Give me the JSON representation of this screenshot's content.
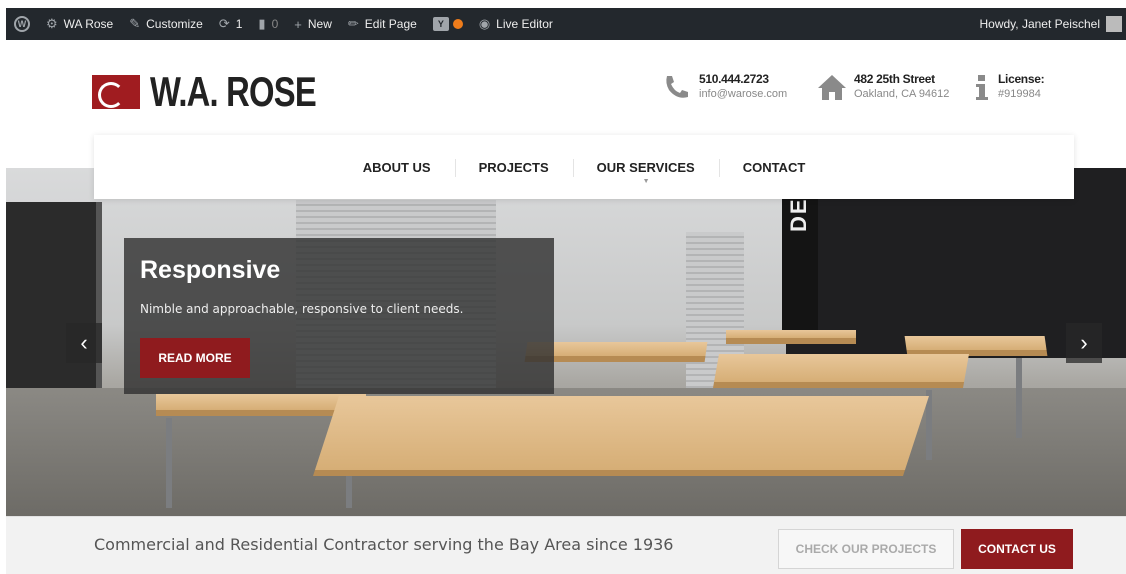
{
  "admin_bar": {
    "wp_logo_glyph": "W",
    "site_name": "WA Rose",
    "customize": "Customize",
    "updates": "1",
    "comments": "0",
    "new": "New",
    "edit_page": "Edit Page",
    "yoast_glyph": "Y",
    "live_editor": "Live Editor",
    "howdy": "Howdy, Janet Peischel",
    "icons": {
      "dashboard": "dashboard-icon",
      "customize": "brush-icon",
      "updates": "refresh-icon",
      "comments": "comment-icon",
      "new": "plus-icon",
      "edit": "pencil-icon",
      "live": "eye-icon"
    }
  },
  "header": {
    "logo_text": "W.A. ROSE",
    "phone": {
      "title": "510.444.2723",
      "sub": "info@warose.com"
    },
    "address": {
      "title": "482 25th Street",
      "sub": "Oakland, CA 94612"
    },
    "license": {
      "title": "License:",
      "sub": "#919984"
    }
  },
  "nav": {
    "items": [
      "ABOUT US",
      "PROJECTS",
      "OUR SERVICES",
      "CONTACT"
    ]
  },
  "hero": {
    "wall_text": "DESIGN",
    "title": "Responsive",
    "text": "Nimble and approachable, responsive to client needs.",
    "button": "READ MORE",
    "prev": "‹",
    "next": "›"
  },
  "bottom": {
    "tagline": "Commercial and Residential Contractor serving the Bay Area since 1936",
    "btn_projects": "CHECK OUR PROJECTS",
    "btn_contact": "CONTACT US"
  },
  "colors": {
    "brand_red": "#8f1b1e",
    "admin_bar": "#23282d",
    "yoast_dot": "#ee7c1b"
  }
}
